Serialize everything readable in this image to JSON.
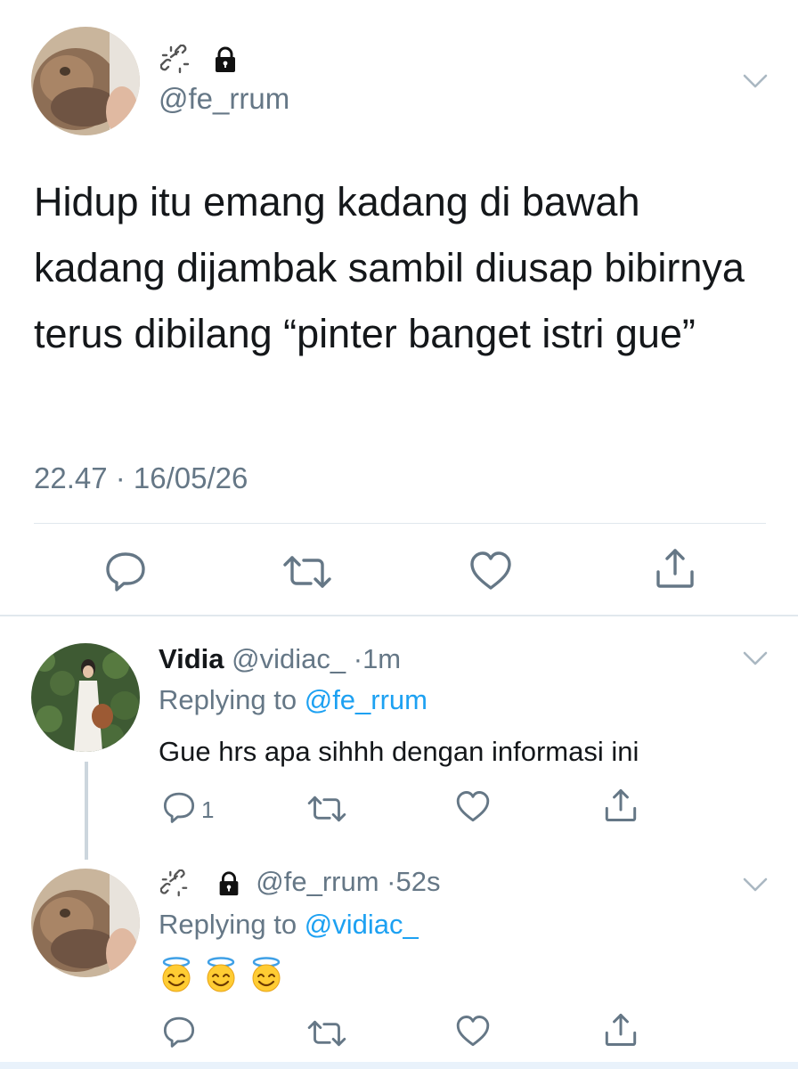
{
  "main_tweet": {
    "handle": "@fe_rrum",
    "name_icons": [
      "broken-link-icon",
      "lock-icon"
    ],
    "text": "Hidup itu emang kadang di bawah kadang dijambak sambil diusap bibirnya terus dibilang “pinter banget istri gue”",
    "timestamp": "22.47 · 16/05/26",
    "actions": [
      "reply-icon",
      "retweet-icon",
      "like-icon",
      "share-icon"
    ]
  },
  "replies": [
    {
      "name": "Vidia",
      "handle": "@vidiac_",
      "time": "1m",
      "replying_prefix": "Replying to ",
      "replying_to": "@fe_rrum",
      "text": "Gue hrs apa sihhh dengan informasi ini",
      "reply_count": "1"
    },
    {
      "handle": "@fe_rrum",
      "time": "52s",
      "replying_prefix": "Replying to ",
      "replying_to": "@vidiac_",
      "text": "😇😇😇"
    }
  ],
  "colors": {
    "text": "#14171a",
    "secondary": "#657786",
    "link": "#1da1f2",
    "divider": "#e1e8ed"
  }
}
